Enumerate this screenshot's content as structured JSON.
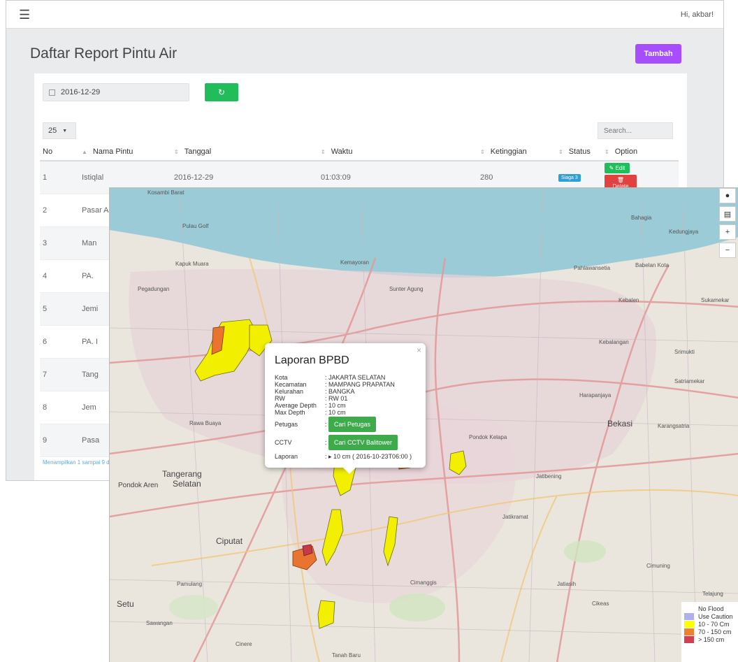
{
  "header": {
    "greeting": "Hi, akbar!"
  },
  "page": {
    "title": "Daftar Report Pintu Air",
    "add_label": "Tambah"
  },
  "filters": {
    "date_value": "2016-12-29",
    "page_size": "25",
    "search_placeholder": "Search..."
  },
  "table": {
    "columns": [
      "No",
      "Nama Pintu",
      "Tanggal",
      "Waktu",
      "Ketinggian",
      "Status",
      "Option"
    ],
    "rows": [
      {
        "no": "1",
        "nama": "Istiqlal",
        "tanggal": "2016-12-29",
        "waktu": "01:03:09",
        "ketinggian": "280",
        "status": "Siaga 3"
      },
      {
        "no": "2",
        "nama": "Pasar Asem"
      },
      {
        "no": "3",
        "nama": "Man"
      },
      {
        "no": "4",
        "nama": "PA."
      },
      {
        "no": "5",
        "nama": "Jemi"
      },
      {
        "no": "6",
        "nama": "PA. I"
      },
      {
        "no": "7",
        "nama": "Tang"
      },
      {
        "no": "8",
        "nama": "Jem"
      },
      {
        "no": "9",
        "nama": "Pasa"
      }
    ],
    "edit_label": "Edit",
    "delete_label": "Delete",
    "info_text": "Menampilkan 1 sampai 9 d"
  },
  "map": {
    "controls": [
      "comment-icon",
      "document-icon",
      "+",
      "−"
    ],
    "popup": {
      "title": "Laporan BPBD",
      "fields": [
        {
          "label": "Kota",
          "value": ": JAKARTA SELATAN"
        },
        {
          "label": "Kecamatan",
          "value": ": MAMPANG PRAPATAN"
        },
        {
          "label": "Kelurahan",
          "value": ": BANGKA"
        },
        {
          "label": "RW",
          "value": ": RW 01"
        },
        {
          "label": "Average Depth",
          "value": ": 10 cm"
        },
        {
          "label": "Max Depth",
          "value": ": 10 cm"
        }
      ],
      "petugas_label": "Petugas",
      "petugas_button": "Cari Petugas",
      "cctv_label": "CCTV",
      "cctv_button": "Cari CCTV Balitower",
      "laporan_label": "Laporan",
      "laporan_value": ": ▸ 10 cm ( 2016-10-23T06:00 )"
    },
    "legend": [
      {
        "label": "No Flood",
        "color": "#ffffff"
      },
      {
        "label": "Use Caution",
        "color": "#b0b0f0"
      },
      {
        "label": "10 - 70 Cm",
        "color": "#ffff00"
      },
      {
        "label": "70 - 150 cm",
        "color": "#f08030"
      },
      {
        "label": "> 150 cm",
        "color": "#d04050"
      }
    ],
    "places": {
      "tangerang": "Tangerang",
      "selatan": "Selatan",
      "ciputat": "Ciputat",
      "bekasi": "Bekasi",
      "pondok_aren": "Pondok Aren",
      "setu": "Setu",
      "kosambi": "Kosambi Barat",
      "pulau": "Pulau Golf",
      "bahagia": "Bahagia",
      "kedungjaya": "Kedungjaya",
      "pahlawan": "Pahlawansetia",
      "babelan": "Babelan Kota",
      "kebalen": "Kebalen",
      "sukamekar": "Sukamekar",
      "srimukti": "Srimukti",
      "kebalangan": "Kebalangan",
      "satria": "Satriamekar",
      "harapanjaya": "Harapanjaya",
      "karang": "Karangsatria",
      "jatibening": "Jatibening",
      "cimuning": "Cimuning",
      "telajung": "Telajung",
      "cikarang": "Cikeas",
      "jatikramat": "Jatikramat",
      "jatiasih": "Jatiasih",
      "pondok_kelapa": "Pondok Kelapa",
      "kemayoran": "Kemayoran",
      "sunter": "Sunter Agung",
      "pengadegan": "Pegadungan",
      "kapuk": "Kapuk Muara",
      "rawabuaya": "Rawa Buaya",
      "pamulang": "Pamulang",
      "sawangan": "Sawangan",
      "cinere": "Cinere",
      "cimanggis": "Cimanggis",
      "depok": "Tanah Baru"
    }
  }
}
